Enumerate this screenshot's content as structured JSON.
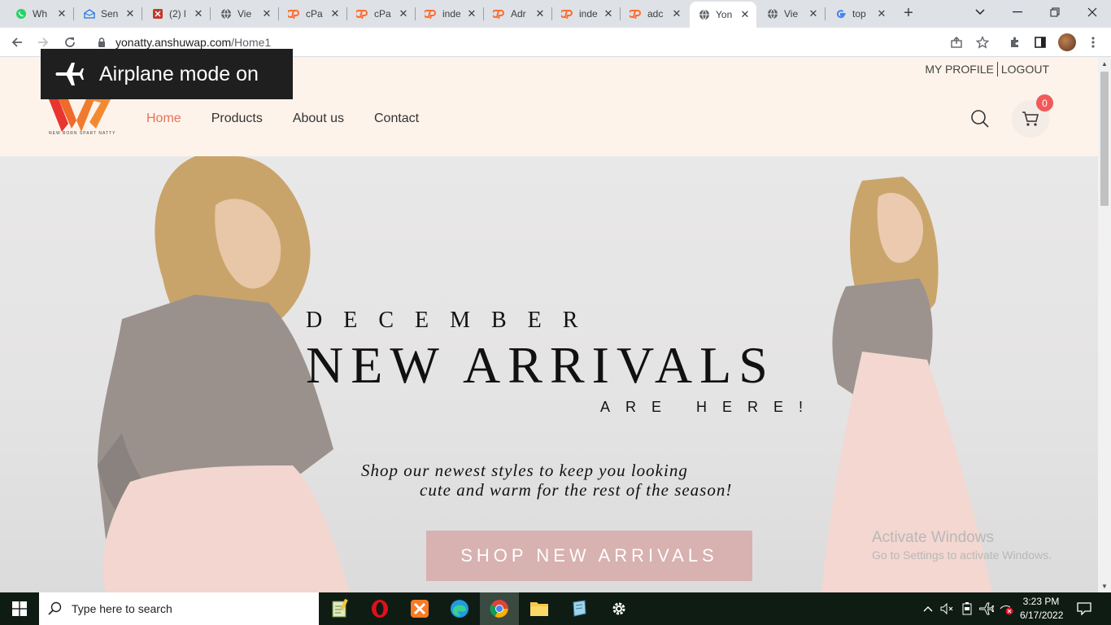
{
  "browser": {
    "tabs": [
      {
        "title": "Wh",
        "icon": "whatsapp-icon",
        "color": "#25d366"
      },
      {
        "title": "Sen",
        "icon": "mail-icon",
        "color": "#1a73e8"
      },
      {
        "title": "(2) l",
        "icon": "app-icon",
        "color": "#c0392b"
      },
      {
        "title": "Vie",
        "icon": "globe-icon",
        "color": "#5f6368"
      },
      {
        "title": "cPa",
        "icon": "cpanel-icon",
        "color": "#ff6c2c"
      },
      {
        "title": "cPa",
        "icon": "cpanel-icon",
        "color": "#ff6c2c"
      },
      {
        "title": "inde",
        "icon": "cpanel-icon",
        "color": "#ff6c2c"
      },
      {
        "title": "Adr",
        "icon": "cpanel-icon",
        "color": "#ff6c2c"
      },
      {
        "title": "inde",
        "icon": "cpanel-icon",
        "color": "#ff6c2c"
      },
      {
        "title": "adc",
        "icon": "cpanel-icon",
        "color": "#ff6c2c"
      },
      {
        "title": "Yon",
        "icon": "globe-icon",
        "color": "#5f6368",
        "active": true
      },
      {
        "title": "Vie",
        "icon": "globe-icon",
        "color": "#5f6368"
      },
      {
        "title": "top",
        "icon": "google-icon",
        "color": "#4285f4"
      }
    ],
    "url_host": "yonatty.anshuwap.com",
    "url_path": "/Home1"
  },
  "notification": {
    "airplane_text": "Airplane mode on"
  },
  "site": {
    "logo_tagline": "NEW BORN SPART NATTY",
    "toplinks": {
      "profile": "MY PROFILE",
      "logout": "LOGOUT"
    },
    "nav": [
      "Home",
      "Products",
      "About us",
      "Contact"
    ],
    "cart_count": "0",
    "accent_color": "#e8735a"
  },
  "hero": {
    "kicker": "DECEMBER",
    "title": "NEW ARRIVALS",
    "tagline": "ARE HERE!",
    "sub_line1": "Shop our newest styles to keep you looking",
    "sub_line2": "cute and warm for the rest of the season!",
    "button": "SHOP NEW ARRIVALS",
    "button_color": "#d8b1b1"
  },
  "watermark": {
    "line1": "Activate Windows",
    "line2": "Go to Settings to activate Windows."
  },
  "taskbar": {
    "search_placeholder": "Type here to search",
    "time": "3:23 PM",
    "date": "6/17/2022"
  }
}
